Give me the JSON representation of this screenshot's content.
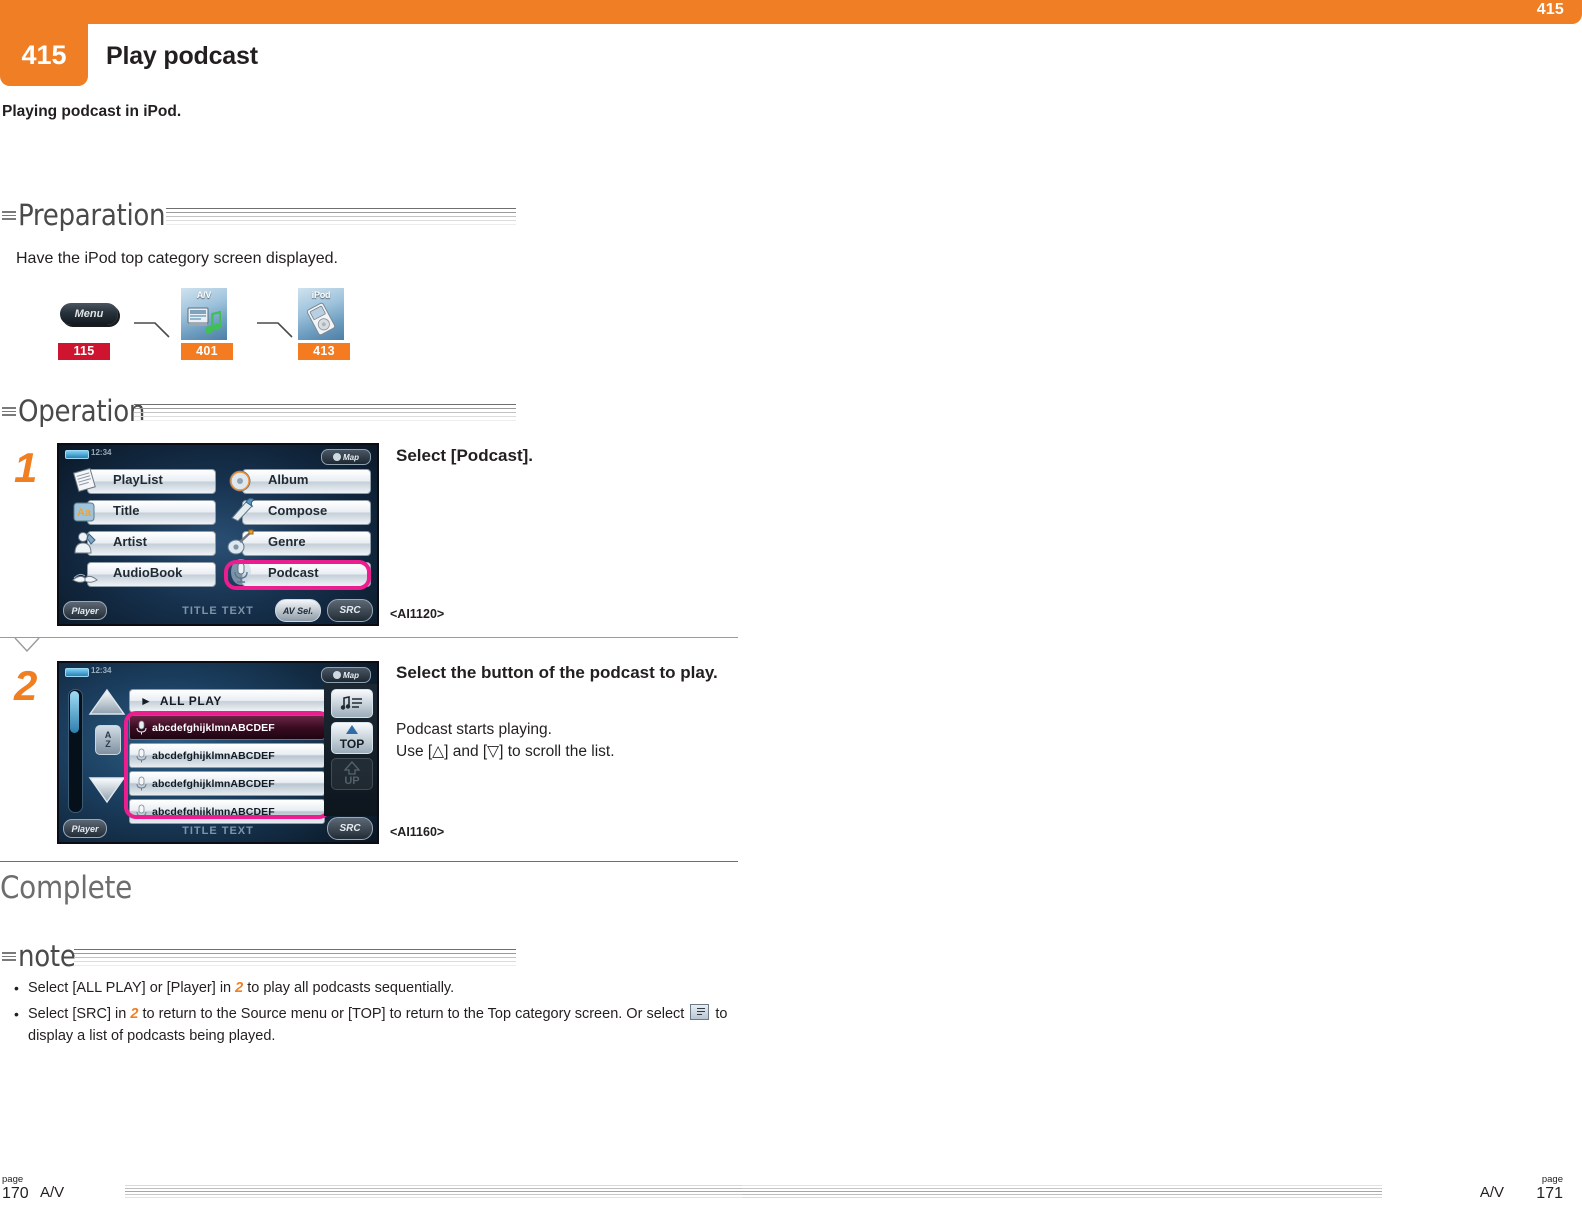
{
  "header": {
    "corner_page": "415",
    "tab_number": "415",
    "title": "Play podcast",
    "intro": "Playing podcast in iPod.",
    "accent_orange": "#ef7e24"
  },
  "preparation": {
    "heading": "Preparation",
    "text": "Have the iPod top category screen displayed.",
    "flow": [
      {
        "icon": "menu-button-icon",
        "caption": "Menu",
        "ref": "115",
        "ref_color": "#cf1430"
      },
      {
        "icon": "av-tile-icon",
        "caption": "A/V",
        "ref": "401",
        "ref_color": "#f47b20"
      },
      {
        "icon": "ipod-tile-icon",
        "caption": "iPod",
        "ref": "413",
        "ref_color": "#f47b20"
      }
    ]
  },
  "operation": {
    "heading": "Operation",
    "steps": [
      {
        "number": "1",
        "ai_ref": "<AI1120>",
        "headline": "Select [Podcast].",
        "body": "",
        "screen": {
          "clock": "12:34",
          "map_button": "Map",
          "menu_items": [
            "PlayList",
            "Album",
            "Title",
            "Compose",
            "Artist",
            "Genre",
            "AudioBook",
            "Podcast"
          ],
          "highlighted_item": "Podcast",
          "bottom_left": "Player",
          "bottom_center": "TITLE TEXT",
          "bottom_buttons": [
            "AV Sel.",
            "SRC"
          ]
        }
      },
      {
        "number": "2",
        "ai_ref": "<AI1160>",
        "headline": "Select the button of the podcast to play.",
        "body_lines": [
          "Podcast starts playing.",
          "Use [△] and [▽] to scroll the list."
        ],
        "screen": {
          "clock": "12:34",
          "map_button": "Map",
          "all_play": "ALL PLAY",
          "list_items": [
            "abcdefghijklmnABCDEF",
            "abcdefghijklmnABCDEF",
            "abcdefghijklmnABCDEF",
            "abcdefghijklmnABCDEF"
          ],
          "selected_index": 0,
          "az_button": "A\nZ",
          "side_buttons": [
            "playlist-icon",
            "TOP",
            "UP"
          ],
          "bottom_left": "Player",
          "bottom_center": "TITLE TEXT",
          "bottom_buttons": [
            "SRC"
          ]
        }
      }
    ]
  },
  "complete_label": "Complete",
  "note": {
    "heading": "note",
    "items": [
      {
        "pre": "Select [ALL PLAY] or [Player] in ",
        "step": "2",
        "post": " to play all podcasts sequentially.",
        "has_icon": false
      },
      {
        "pre": "Select [SRC] in ",
        "step": "2",
        "post": " to return to the Source menu or [TOP] to return to the Top category screen. Or select ",
        "post2": " to display a list of podcasts being played.",
        "has_icon": true
      }
    ]
  },
  "footer": {
    "left_page_label": "page",
    "left_page_number": "170",
    "left_section": "A/V",
    "right_section": "A/V",
    "right_page_label": "page",
    "right_page_number": "171"
  }
}
